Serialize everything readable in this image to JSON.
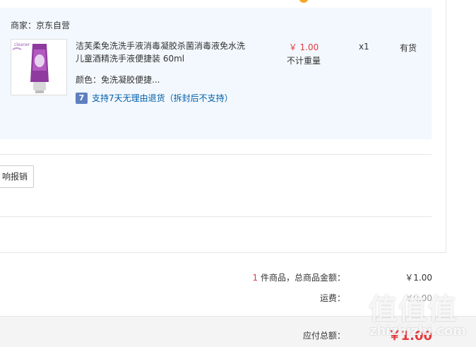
{
  "order": {
    "merchant_label": "商家：京东自营",
    "product": {
      "name": "洁芙柔免洗洗手液消毒凝胶杀菌消毒液免水洗儿童酒精洗手液便捷装 60ml",
      "price": "￥ 1.00",
      "weight_note": "不计重量",
      "quantity": "x1",
      "stock_status": "有货",
      "attribute": "颜色：免洗凝胶便捷...",
      "return_badge": "7",
      "return_policy": "支持7天无理由退货（拆封后不支持）"
    },
    "report_button": "响报销"
  },
  "summary": {
    "items_prefix_count": "1",
    "items_label": " 件商品，总商品金额：",
    "items_total": "￥1.00",
    "shipping_label": "运费：",
    "shipping_value": "￥0.00",
    "payable_label": "应付总额：",
    "payable_value": "￥1.00"
  },
  "watermark": {
    "text": "值值值",
    "sub": "zhizhizhi.com"
  },
  "colors": {
    "accent_red": "#e4393c",
    "link_blue": "#005ea7",
    "panel_bg": "#f3f8fe"
  },
  "icons": {
    "seven_day_return": "seven-day-return-icon",
    "product_thumb": "product-image"
  }
}
